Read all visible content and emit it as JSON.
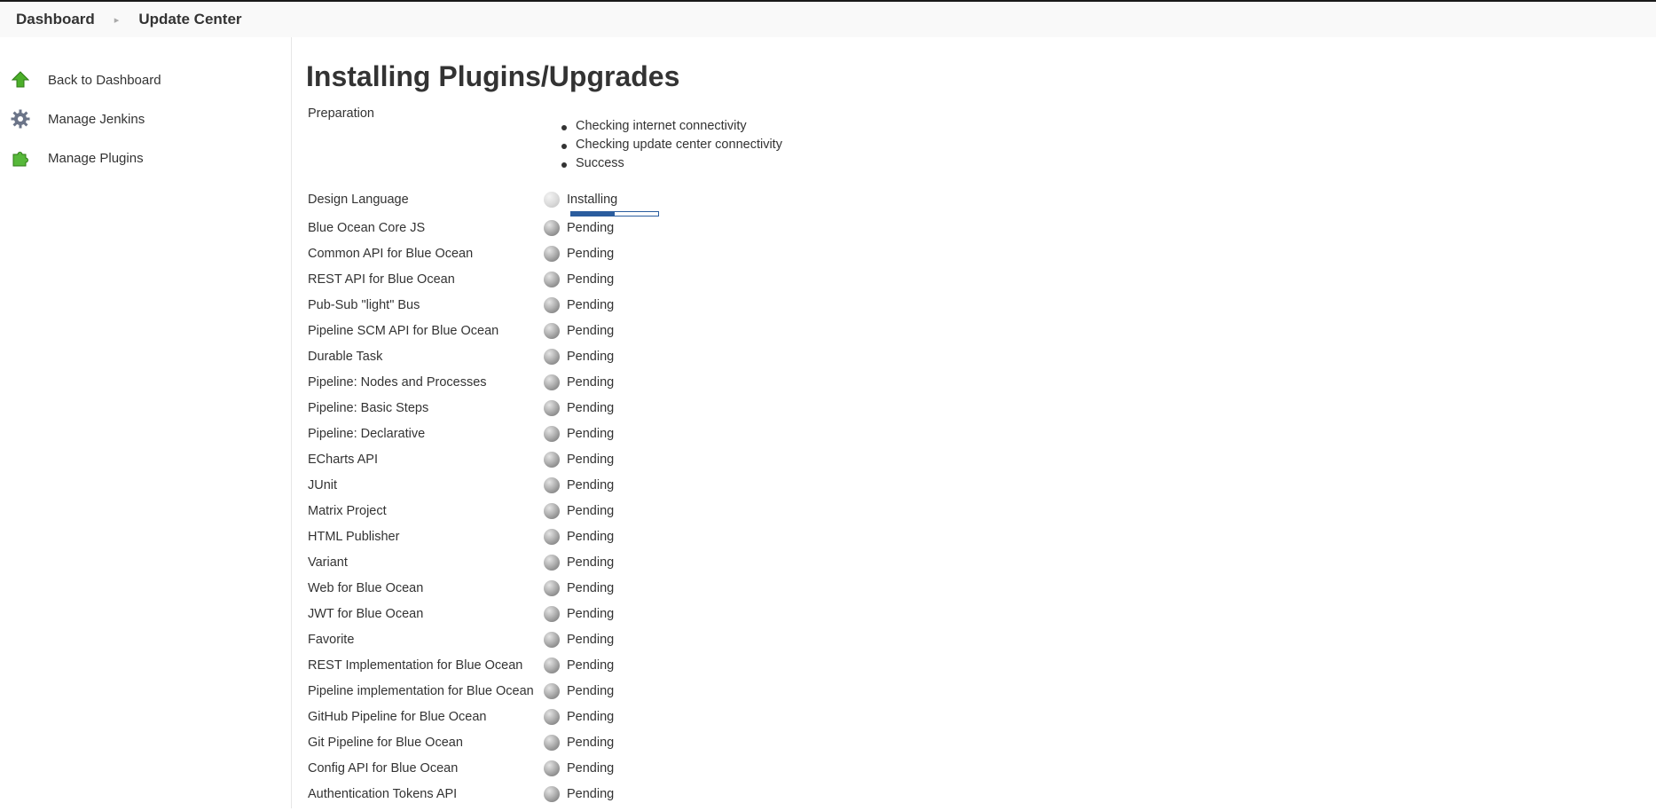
{
  "breadcrumbs": [
    "Dashboard",
    "Update Center"
  ],
  "sidebar": {
    "items": [
      {
        "label": "Back to Dashboard",
        "icon": "up-arrow-icon"
      },
      {
        "label": "Manage Jenkins",
        "icon": "gear-icon"
      },
      {
        "label": "Manage Plugins",
        "icon": "puzzle-icon"
      }
    ]
  },
  "page_title": "Installing Plugins/Upgrades",
  "preparation": {
    "label": "Preparation",
    "steps": [
      "Checking internet connectivity",
      "Checking update center connectivity",
      "Success"
    ]
  },
  "installing": {
    "name": "Design Language",
    "status": "Installing",
    "progress": 0.5
  },
  "plugins": [
    {
      "name": "Blue Ocean Core JS",
      "status": "Pending"
    },
    {
      "name": "Common API for Blue Ocean",
      "status": "Pending"
    },
    {
      "name": "REST API for Blue Ocean",
      "status": "Pending"
    },
    {
      "name": "Pub-Sub \"light\" Bus",
      "status": "Pending"
    },
    {
      "name": "Pipeline SCM API for Blue Ocean",
      "status": "Pending"
    },
    {
      "name": "Durable Task",
      "status": "Pending"
    },
    {
      "name": "Pipeline: Nodes and Processes",
      "status": "Pending"
    },
    {
      "name": "Pipeline: Basic Steps",
      "status": "Pending"
    },
    {
      "name": "Pipeline: Declarative",
      "status": "Pending"
    },
    {
      "name": "ECharts API",
      "status": "Pending"
    },
    {
      "name": "JUnit",
      "status": "Pending"
    },
    {
      "name": "Matrix Project",
      "status": "Pending"
    },
    {
      "name": "HTML Publisher",
      "status": "Pending"
    },
    {
      "name": "Variant",
      "status": "Pending"
    },
    {
      "name": "Web for Blue Ocean",
      "status": "Pending"
    },
    {
      "name": "JWT for Blue Ocean",
      "status": "Pending"
    },
    {
      "name": "Favorite",
      "status": "Pending"
    },
    {
      "name": "REST Implementation for Blue Ocean",
      "status": "Pending"
    },
    {
      "name": "Pipeline implementation for Blue Ocean",
      "status": "Pending"
    },
    {
      "name": "GitHub Pipeline for Blue Ocean",
      "status": "Pending"
    },
    {
      "name": "Git Pipeline for Blue Ocean",
      "status": "Pending"
    },
    {
      "name": "Config API for Blue Ocean",
      "status": "Pending"
    },
    {
      "name": "Authentication Tokens API",
      "status": "Pending"
    }
  ]
}
